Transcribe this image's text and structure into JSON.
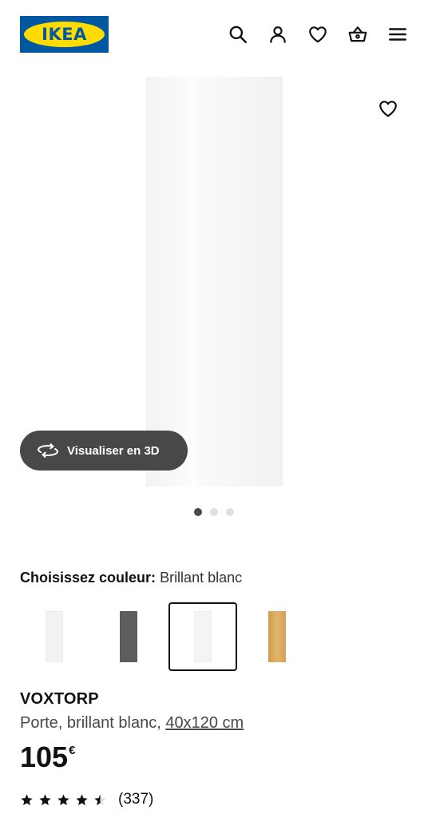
{
  "header": {
    "logo_text": "IKEA",
    "icons": [
      "search-icon",
      "account-icon",
      "heart-icon",
      "basket-icon",
      "menu-icon"
    ]
  },
  "media": {
    "visualize_label": "Visualiser en 3D",
    "dots_total": 3,
    "dots_active_index": 0
  },
  "color": {
    "label": "Choisissez couleur:",
    "value": "Brillant blanc",
    "swatches": [
      {
        "name": "white",
        "color": "#f2f2f2"
      },
      {
        "name": "dark-grey",
        "color": "#5d5d5d"
      },
      {
        "name": "brilliant-white",
        "color": "#f4f4f4",
        "selected": true
      },
      {
        "name": "oak",
        "color": "#d8a85a"
      }
    ]
  },
  "product": {
    "name": "VOXTORP",
    "description": "Porte, brillant blanc, ",
    "size": "40x120 cm",
    "price": "105",
    "currency": "€",
    "rating": 4.5,
    "rating_count": "(337)"
  },
  "colors": {
    "brand_blue": "#0058a3",
    "brand_yellow": "#ffdb00",
    "button_dark": "#484848"
  }
}
